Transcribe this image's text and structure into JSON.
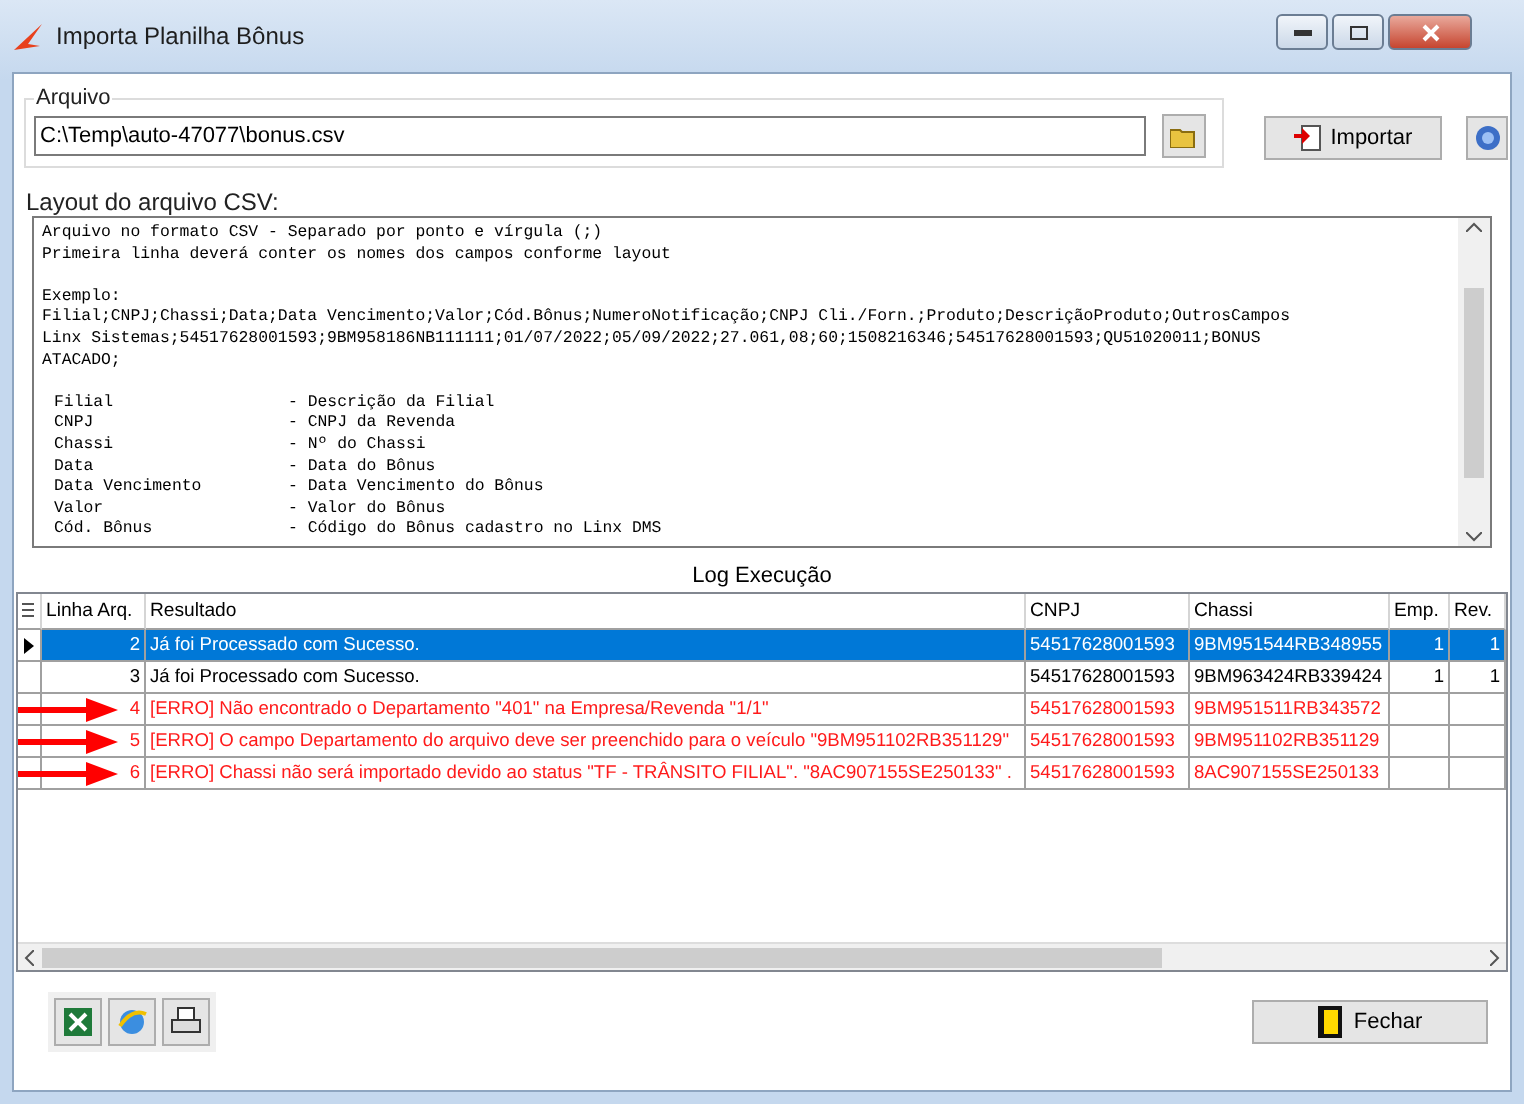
{
  "window": {
    "title": "Importa Planilha Bônus"
  },
  "arquivo": {
    "legend": "Arquivo",
    "value": "C:\\Temp\\auto-47077\\bonus.csv",
    "import_button": "Importar"
  },
  "layout": {
    "legend": "Layout do arquivo CSV:",
    "intro": [
      [
        "Arquivo no formato CSV - Separado por ponto e vírgula (;)",
        "Primeira linha deverá conter os nomes dos campos conforme layout"
      ],
      [
        "Exemplo:",
        "Filial;CNPJ;Chassi;Data;Data Vencimento;Valor;Cód.Bônus;NumeroNotificação;CNPJ Cli./Forn.;Produto;DescriçãoProduto;OutrosCampos",
        "Linx Sistemas;54517628001593;9BM958186NB111111;01/07/2022;05/09/2022;27.061,08;60;1508216346;54517628001593;QU51020011;BONUS",
        "ATACADO;"
      ]
    ],
    "fields": [
      {
        "name": "Filial",
        "description": "- Descrição da Filial"
      },
      {
        "name": "CNPJ",
        "description": "- CNPJ da Revenda"
      },
      {
        "name": "Chassi",
        "description": "- Nº do Chassi"
      },
      {
        "name": "Data",
        "description": "- Data do Bônus"
      },
      {
        "name": "Data Vencimento",
        "description": "- Data Vencimento do Bônus"
      },
      {
        "name": "Valor",
        "description": "- Valor do Bônus"
      },
      {
        "name": "Cód. Bônus",
        "description": "- Código do Bônus cadastro no Linx DMS"
      }
    ]
  },
  "log": {
    "title": "Log Execução",
    "columns": [
      "Linha Arq.",
      "Resultado",
      "CNPJ",
      "Chassi",
      "Emp.",
      "Rev."
    ],
    "rows": [
      {
        "kind": "success",
        "selected": true,
        "flagged": false,
        "cells": [
          "2",
          "Já foi Processado com Sucesso.",
          "54517628001593",
          "9BM951544RB348955",
          "1",
          "1"
        ]
      },
      {
        "kind": "success",
        "selected": false,
        "flagged": false,
        "cells": [
          "3",
          "Já foi Processado com Sucesso.",
          "54517628001593",
          "9BM963424RB339424",
          "1",
          "1"
        ]
      },
      {
        "kind": "error",
        "selected": false,
        "flagged": true,
        "cells": [
          "4",
          "[ERRO] Não encontrado o Departamento \"401\" na Empresa/Revenda \"1/1\"",
          "54517628001593",
          "9BM951511RB343572",
          "",
          ""
        ]
      },
      {
        "kind": "error",
        "selected": false,
        "flagged": true,
        "cells": [
          "5",
          "[ERRO] O campo Departamento do arquivo deve ser preenchido para o veículo \"9BM951102RB351129\"",
          "54517628001593",
          "9BM951102RB351129",
          "",
          ""
        ]
      },
      {
        "kind": "error",
        "selected": false,
        "flagged": true,
        "cells": [
          "6",
          "[ERRO] Chassi não será importado devido ao status \"TF - TRÂNSITO FILIAL\". \"8AC907155SE250133\" .",
          "54517628001593",
          "8AC907155SE250133",
          "",
          ""
        ]
      }
    ]
  },
  "close_button": "Fechar"
}
